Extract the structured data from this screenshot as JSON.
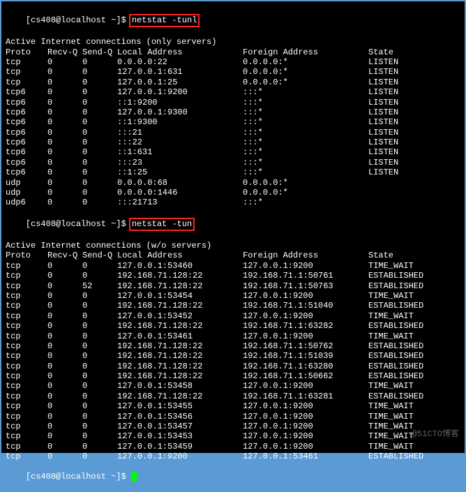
{
  "prompt1": "[cs408@localhost ~]$",
  "cmd1": "netstat -tunl",
  "heading1": "Active Internet connections (only servers)",
  "cols": {
    "proto": "Proto",
    "recvq": "Recv-Q",
    "sendq": "Send-Q",
    "local": "Local Address",
    "foreign": "Foreign Address",
    "state": "State"
  },
  "rows1": [
    {
      "proto": "tcp",
      "recvq": "0",
      "sendq": "0",
      "local": "0.0.0.0:22",
      "foreign": "0.0.0.0:*",
      "state": "LISTEN"
    },
    {
      "proto": "tcp",
      "recvq": "0",
      "sendq": "0",
      "local": "127.0.0.1:631",
      "foreign": "0.0.0.0:*",
      "state": "LISTEN"
    },
    {
      "proto": "tcp",
      "recvq": "0",
      "sendq": "0",
      "local": "127.0.0.1:25",
      "foreign": "0.0.0.0:*",
      "state": "LISTEN"
    },
    {
      "proto": "tcp6",
      "recvq": "0",
      "sendq": "0",
      "local": "127.0.0.1:9200",
      "foreign": ":::*",
      "state": "LISTEN"
    },
    {
      "proto": "tcp6",
      "recvq": "0",
      "sendq": "0",
      "local": "::1:9200",
      "foreign": ":::*",
      "state": "LISTEN"
    },
    {
      "proto": "tcp6",
      "recvq": "0",
      "sendq": "0",
      "local": "127.0.0.1:9300",
      "foreign": ":::*",
      "state": "LISTEN"
    },
    {
      "proto": "tcp6",
      "recvq": "0",
      "sendq": "0",
      "local": "::1:9300",
      "foreign": ":::*",
      "state": "LISTEN"
    },
    {
      "proto": "tcp6",
      "recvq": "0",
      "sendq": "0",
      "local": ":::21",
      "foreign": ":::*",
      "state": "LISTEN"
    },
    {
      "proto": "tcp6",
      "recvq": "0",
      "sendq": "0",
      "local": ":::22",
      "foreign": ":::*",
      "state": "LISTEN"
    },
    {
      "proto": "tcp6",
      "recvq": "0",
      "sendq": "0",
      "local": "::1:631",
      "foreign": ":::*",
      "state": "LISTEN"
    },
    {
      "proto": "tcp6",
      "recvq": "0",
      "sendq": "0",
      "local": ":::23",
      "foreign": ":::*",
      "state": "LISTEN"
    },
    {
      "proto": "tcp6",
      "recvq": "0",
      "sendq": "0",
      "local": "::1:25",
      "foreign": ":::*",
      "state": "LISTEN"
    },
    {
      "proto": "udp",
      "recvq": "0",
      "sendq": "0",
      "local": "0.0.0.0:68",
      "foreign": "0.0.0.0:*",
      "state": ""
    },
    {
      "proto": "udp",
      "recvq": "0",
      "sendq": "0",
      "local": "0.0.0.0:1446",
      "foreign": "0.0.0.0:*",
      "state": ""
    },
    {
      "proto": "udp6",
      "recvq": "0",
      "sendq": "0",
      "local": ":::21713",
      "foreign": ":::*",
      "state": ""
    }
  ],
  "prompt2": "[cs408@localhost ~]$",
  "cmd2": "netstat -tun",
  "heading2": "Active Internet connections (w/o servers)",
  "rows2": [
    {
      "proto": "tcp",
      "recvq": "0",
      "sendq": "0",
      "local": "127.0.0.1:53460",
      "foreign": "127.0.0.1:9200",
      "state": "TIME_WAIT"
    },
    {
      "proto": "tcp",
      "recvq": "0",
      "sendq": "0",
      "local": "192.168.71.128:22",
      "foreign": "192.168.71.1:50761",
      "state": "ESTABLISHED"
    },
    {
      "proto": "tcp",
      "recvq": "0",
      "sendq": "52",
      "local": "192.168.71.128:22",
      "foreign": "192.168.71.1:50763",
      "state": "ESTABLISHED"
    },
    {
      "proto": "tcp",
      "recvq": "0",
      "sendq": "0",
      "local": "127.0.0.1:53454",
      "foreign": "127.0.0.1:9200",
      "state": "TIME_WAIT"
    },
    {
      "proto": "tcp",
      "recvq": "0",
      "sendq": "0",
      "local": "192.168.71.128:22",
      "foreign": "192.168.71.1:51040",
      "state": "ESTABLISHED"
    },
    {
      "proto": "tcp",
      "recvq": "0",
      "sendq": "0",
      "local": "127.0.0.1:53452",
      "foreign": "127.0.0.1:9200",
      "state": "TIME_WAIT"
    },
    {
      "proto": "tcp",
      "recvq": "0",
      "sendq": "0",
      "local": "192.168.71.128:22",
      "foreign": "192.168.71.1:63282",
      "state": "ESTABLISHED"
    },
    {
      "proto": "tcp",
      "recvq": "0",
      "sendq": "0",
      "local": "127.0.0.1:53461",
      "foreign": "127.0.0.1:9200",
      "state": "TIME_WAIT"
    },
    {
      "proto": "tcp",
      "recvq": "0",
      "sendq": "0",
      "local": "192.168.71.128:22",
      "foreign": "192.168.71.1:50762",
      "state": "ESTABLISHED"
    },
    {
      "proto": "tcp",
      "recvq": "0",
      "sendq": "0",
      "local": "192.168.71.128:22",
      "foreign": "192.168.71.1:51039",
      "state": "ESTABLISHED"
    },
    {
      "proto": "tcp",
      "recvq": "0",
      "sendq": "0",
      "local": "192.168.71.128:22",
      "foreign": "192.168.71.1:63280",
      "state": "ESTABLISHED"
    },
    {
      "proto": "tcp",
      "recvq": "0",
      "sendq": "0",
      "local": "192.168.71.128:22",
      "foreign": "192.168.71.1:50662",
      "state": "ESTABLISHED"
    },
    {
      "proto": "tcp",
      "recvq": "0",
      "sendq": "0",
      "local": "127.0.0.1:53458",
      "foreign": "127.0.0.1:9200",
      "state": "TIME_WAIT"
    },
    {
      "proto": "tcp",
      "recvq": "0",
      "sendq": "0",
      "local": "192.168.71.128:22",
      "foreign": "192.168.71.1:63281",
      "state": "ESTABLISHED"
    },
    {
      "proto": "tcp",
      "recvq": "0",
      "sendq": "0",
      "local": "127.0.0.1:53455",
      "foreign": "127.0.0.1:9200",
      "state": "TIME_WAIT"
    },
    {
      "proto": "tcp",
      "recvq": "0",
      "sendq": "0",
      "local": "127.0.0.1:53456",
      "foreign": "127.0.0.1:9200",
      "state": "TIME_WAIT"
    },
    {
      "proto": "tcp",
      "recvq": "0",
      "sendq": "0",
      "local": "127.0.0.1:53457",
      "foreign": "127.0.0.1:9200",
      "state": "TIME_WAIT"
    },
    {
      "proto": "tcp",
      "recvq": "0",
      "sendq": "0",
      "local": "127.0.0.1:53453",
      "foreign": "127.0.0.1:9200",
      "state": "TIME_WAIT"
    },
    {
      "proto": "tcp",
      "recvq": "0",
      "sendq": "0",
      "local": "127.0.0.1:53459",
      "foreign": "127.0.0.1:9200",
      "state": "TIME_WAIT"
    },
    {
      "proto": "tcp",
      "recvq": "0",
      "sendq": "0",
      "local": "127.0.0.1:9200",
      "foreign": "127.0.0.1:53461",
      "state": "ESTABLISHED"
    }
  ],
  "prompt3": "[cs408@localhost ~]$",
  "watermark": "@51CTO博客"
}
